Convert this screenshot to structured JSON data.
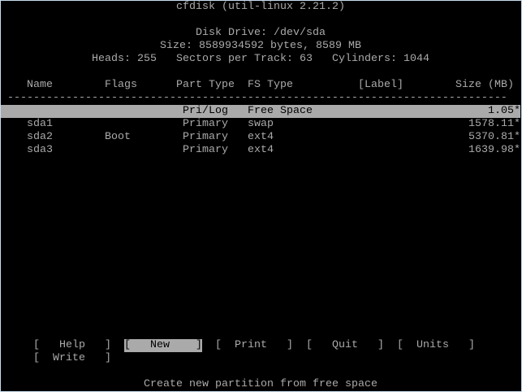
{
  "title": "cfdisk (util-linux 2.21.2)",
  "disk": {
    "drive": "Disk Drive: /dev/sda",
    "size": "Size: 8589934592 bytes, 8589 MB",
    "geometry": "Heads: 255   Sectors per Track: 63   Cylinders: 1044"
  },
  "columns": {
    "name": "Name",
    "flags": "Flags",
    "part_type": "Part Type",
    "fs_type": "FS Type",
    "label": "[Label]",
    "size": "Size (MB)"
  },
  "separator": "-----------------------------------------------------------------------------",
  "rows": [
    {
      "name": "",
      "flags": "",
      "part_type": "Pri/Log",
      "fs_type": "Free Space",
      "label": "",
      "size": "1.05*"
    },
    {
      "name": "sda1",
      "flags": "",
      "part_type": "Primary",
      "fs_type": "swap",
      "label": "",
      "size": "1578.11*"
    },
    {
      "name": "sda2",
      "flags": "Boot",
      "part_type": "Primary",
      "fs_type": "ext4",
      "label": "",
      "size": "5370.81*"
    },
    {
      "name": "sda3",
      "flags": "",
      "part_type": "Primary",
      "fs_type": "ext4",
      "label": "",
      "size": "1639.98*"
    }
  ],
  "menu": {
    "help": "[   Help   ]",
    "new": "[   New    ]",
    "print": "[  Print   ]",
    "quit": "[   Quit   ]",
    "units": "[  Units   ]",
    "write": "[  Write   ]"
  },
  "status": "Create new partition from free space",
  "colors": {
    "fg": "#aaaaaa",
    "bg": "#000000",
    "highlight": "#aaaaaa"
  }
}
